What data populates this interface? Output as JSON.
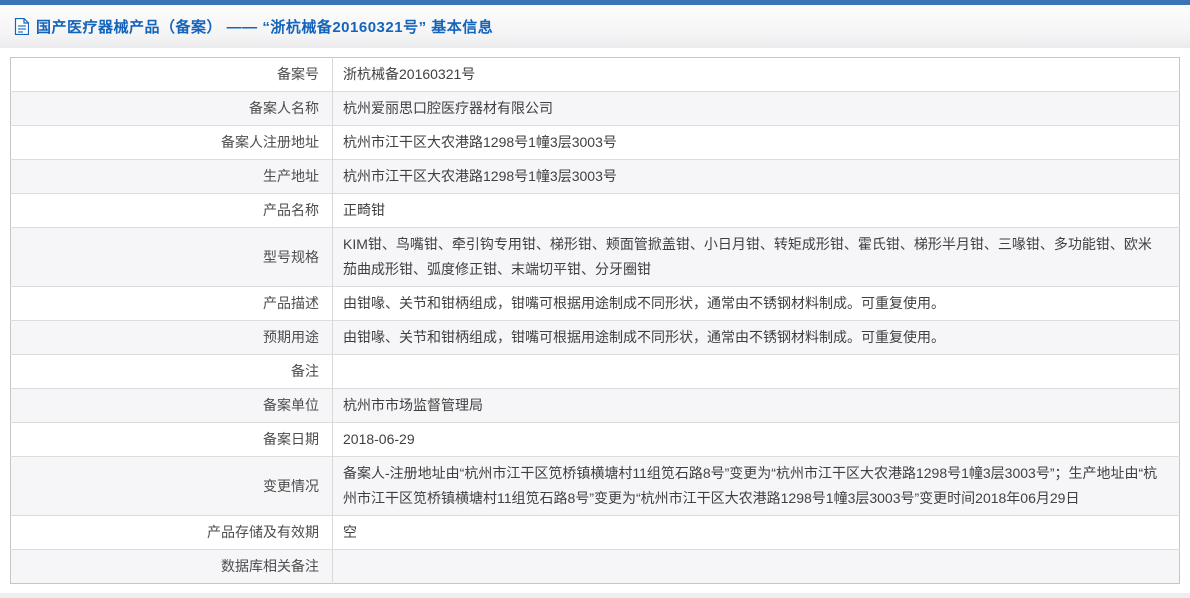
{
  "header": {
    "icon": "document-icon",
    "title": "国产医疗器械产品（备案） —— “浙杭械备20160321号” 基本信息"
  },
  "colors": {
    "topbar_blue": "#3a76b6",
    "title_blue": "#1464bb",
    "row_alt_gray": "#f6f6f8",
    "border_gray": "#c6c6c6"
  },
  "table": {
    "rows": [
      {
        "label": "备案号",
        "value": "浙杭械备20160321号"
      },
      {
        "label": "备案人名称",
        "value": "杭州爱丽思口腔医疗器材有限公司"
      },
      {
        "label": "备案人注册地址",
        "value": "杭州市江干区大农港路1298号1幢3层3003号"
      },
      {
        "label": "生产地址",
        "value": "杭州市江干区大农港路1298号1幢3层3003号"
      },
      {
        "label": "产品名称",
        "value": "正畸钳"
      },
      {
        "label": "型号规格",
        "value": "KIM钳、鸟嘴钳、牵引钩专用钳、梯形钳、颊面管掀盖钳、小日月钳、转矩成形钳、霍氏钳、梯形半月钳、三喙钳、多功能钳、欧米茄曲成形钳、弧度修正钳、末端切平钳、分牙圈钳"
      },
      {
        "label": "产品描述",
        "value": "由钳喙、关节和钳柄组成，钳嘴可根据用途制成不同形状，通常由不锈钢材料制成。可重复使用。"
      },
      {
        "label": "预期用途",
        "value": "由钳喙、关节和钳柄组成，钳嘴可根据用途制成不同形状，通常由不锈钢材料制成。可重复使用。"
      },
      {
        "label": "备注",
        "value": ""
      },
      {
        "label": "备案单位",
        "value": "杭州市市场监督管理局"
      },
      {
        "label": "备案日期",
        "value": "2018-06-29"
      },
      {
        "label": "变更情况",
        "value": "备案人-注册地址由“杭州市江干区笕桥镇横塘村11组笕石路8号”变更为“杭州市江干区大农港路1298号1幢3层3003号”；生产地址由“杭州市江干区笕桥镇横塘村11组笕石路8号”变更为“杭州市江干区大农港路1298号1幢3层3003号”变更时间2018年06月29日"
      },
      {
        "label": "产品存储及有效期",
        "value": "空"
      },
      {
        "label": "数据库相关备注",
        "value": ""
      }
    ]
  }
}
